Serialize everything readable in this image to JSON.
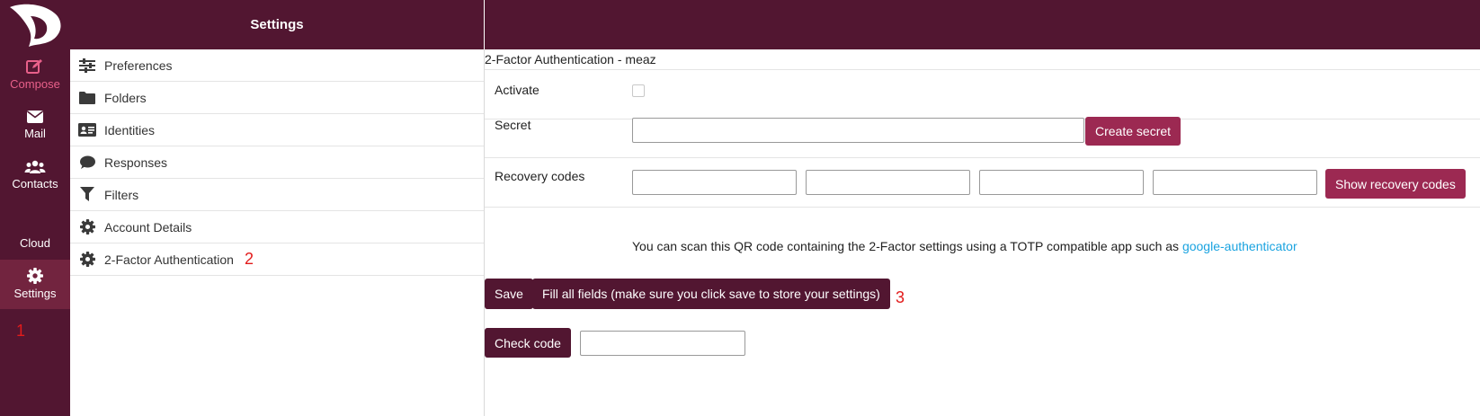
{
  "nav": {
    "items": [
      {
        "label": "Compose",
        "icon": "compose-icon"
      },
      {
        "label": "Mail",
        "icon": "mail-icon"
      },
      {
        "label": "Contacts",
        "icon": "contacts-icon"
      },
      {
        "label": "Cloud",
        "icon": "cloud-icon"
      },
      {
        "label": "Settings",
        "icon": "gear-icon"
      }
    ],
    "annotation": "1"
  },
  "settings_panel": {
    "title": "Settings",
    "items": [
      {
        "label": "Preferences",
        "icon": "sliders-icon"
      },
      {
        "label": "Folders",
        "icon": "folder-icon"
      },
      {
        "label": "Identities",
        "icon": "id-card-icon"
      },
      {
        "label": "Responses",
        "icon": "comment-icon"
      },
      {
        "label": "Filters",
        "icon": "filter-icon"
      },
      {
        "label": "Account Details",
        "icon": "gear-icon"
      },
      {
        "label": "2-Factor Authentication",
        "icon": "gear-icon"
      }
    ],
    "annotation": "2"
  },
  "content": {
    "title": "2-Factor Authentication - meaz",
    "activate_label": "Activate",
    "secret_label": "Secret",
    "secret_value": "",
    "create_secret_label": "Create secret",
    "recovery_label": "Recovery codes",
    "recovery_codes": [
      "",
      "",
      "",
      ""
    ],
    "show_recovery_label": "Show recovery codes",
    "qr_text": "You can scan this QR code containing the 2-Factor settings using a TOTP compatible app such as ",
    "qr_link": "google-authenticator",
    "save_label": "Save",
    "fill_label": "Fill all fields (make sure you click save to store your settings)",
    "annotation": "3",
    "check_code_label": "Check code",
    "check_code_value": ""
  },
  "colors": {
    "brand": "#521631",
    "button_rose": "#9c2952",
    "compose": "#e8608a",
    "link": "#1aa3e0",
    "annotation": "#e21b1b"
  }
}
